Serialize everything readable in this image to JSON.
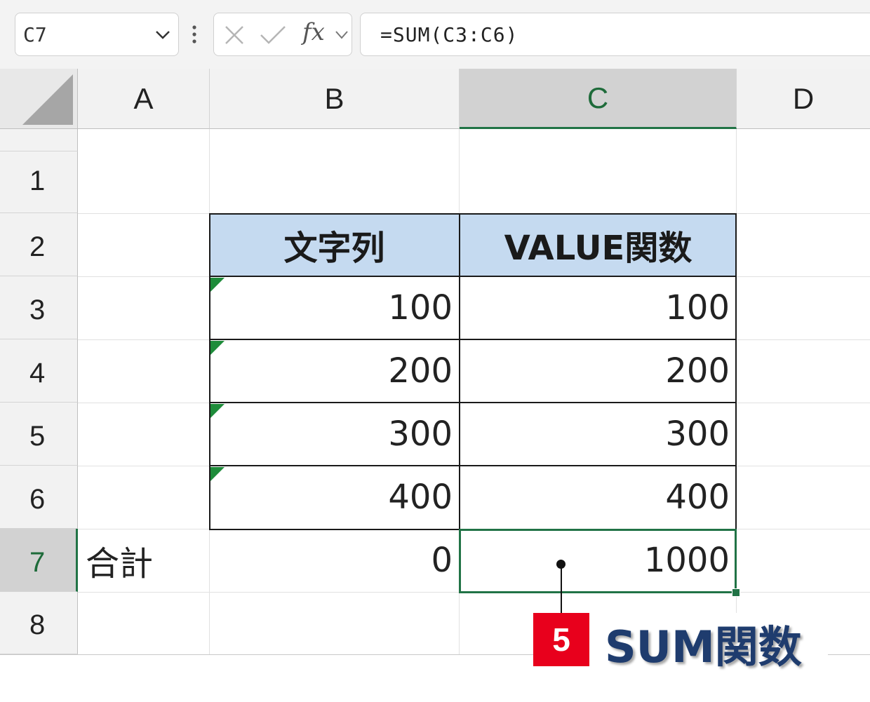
{
  "formula_bar": {
    "name_box": "C7",
    "fx_label": "fx",
    "formula": "=SUM(C3:C6)"
  },
  "columns": [
    "A",
    "B",
    "C",
    "D"
  ],
  "selected_column": "C",
  "rows": [
    "1",
    "2",
    "3",
    "4",
    "5",
    "6",
    "7",
    "8"
  ],
  "selected_row": "7",
  "table": {
    "header_b": "文字列",
    "header_c": "VALUE関数",
    "rows": [
      {
        "b": "100",
        "c": "100"
      },
      {
        "b": "200",
        "c": "200"
      },
      {
        "b": "300",
        "c": "300"
      },
      {
        "b": "400",
        "c": "400"
      }
    ]
  },
  "total_row": {
    "label": "合計",
    "b": "0",
    "c": "1000"
  },
  "annotation": {
    "number": "5",
    "text": "SUM関数"
  },
  "colors": {
    "accent": "#217346",
    "header_fill": "#c5daf0",
    "badge": "#e8001c",
    "callout_text": "#1f3c6e",
    "error_indicator": "#1e8c3a"
  }
}
